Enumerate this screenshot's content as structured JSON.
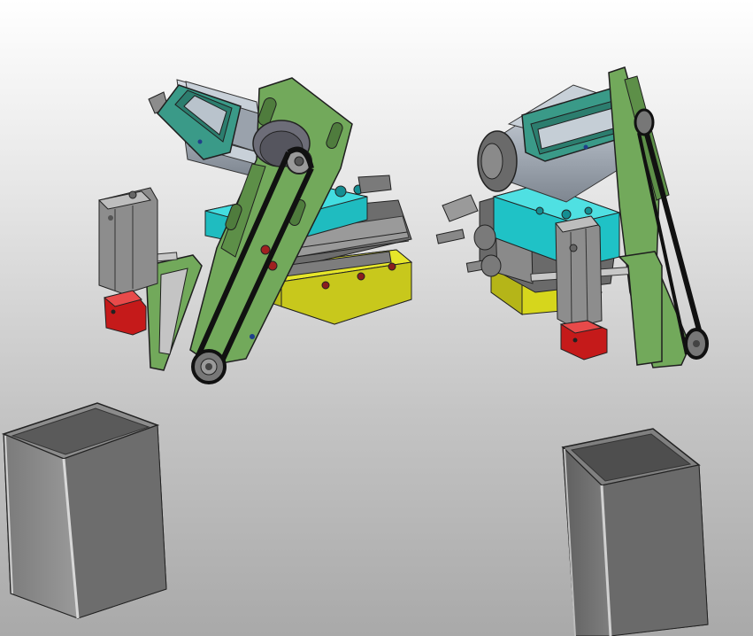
{
  "scene": {
    "kind": "cad-render",
    "assemblies": [
      {
        "name": "left-belt-drive-gripper",
        "view": "front-left"
      },
      {
        "name": "right-belt-drive-gripper",
        "view": "rear-right"
      }
    ],
    "containers": [
      {
        "name": "left-sheet-metal-box"
      },
      {
        "name": "right-sheet-metal-box"
      }
    ],
    "colors": {
      "background_top": "#ffffff",
      "background_bottom": "#a9a9a9",
      "frame_plate": "#74a85c",
      "motor_bracket": "#3f9e8c",
      "motor_body": "#b5bdc7",
      "slide_block": "#22cfd2",
      "base_plate": "#d6d61c",
      "jaw_block": "#d51d1d",
      "belt": "#1a1a1a",
      "cylinder_body": "#909090",
      "box_wall": "#8a8a8a"
    }
  }
}
